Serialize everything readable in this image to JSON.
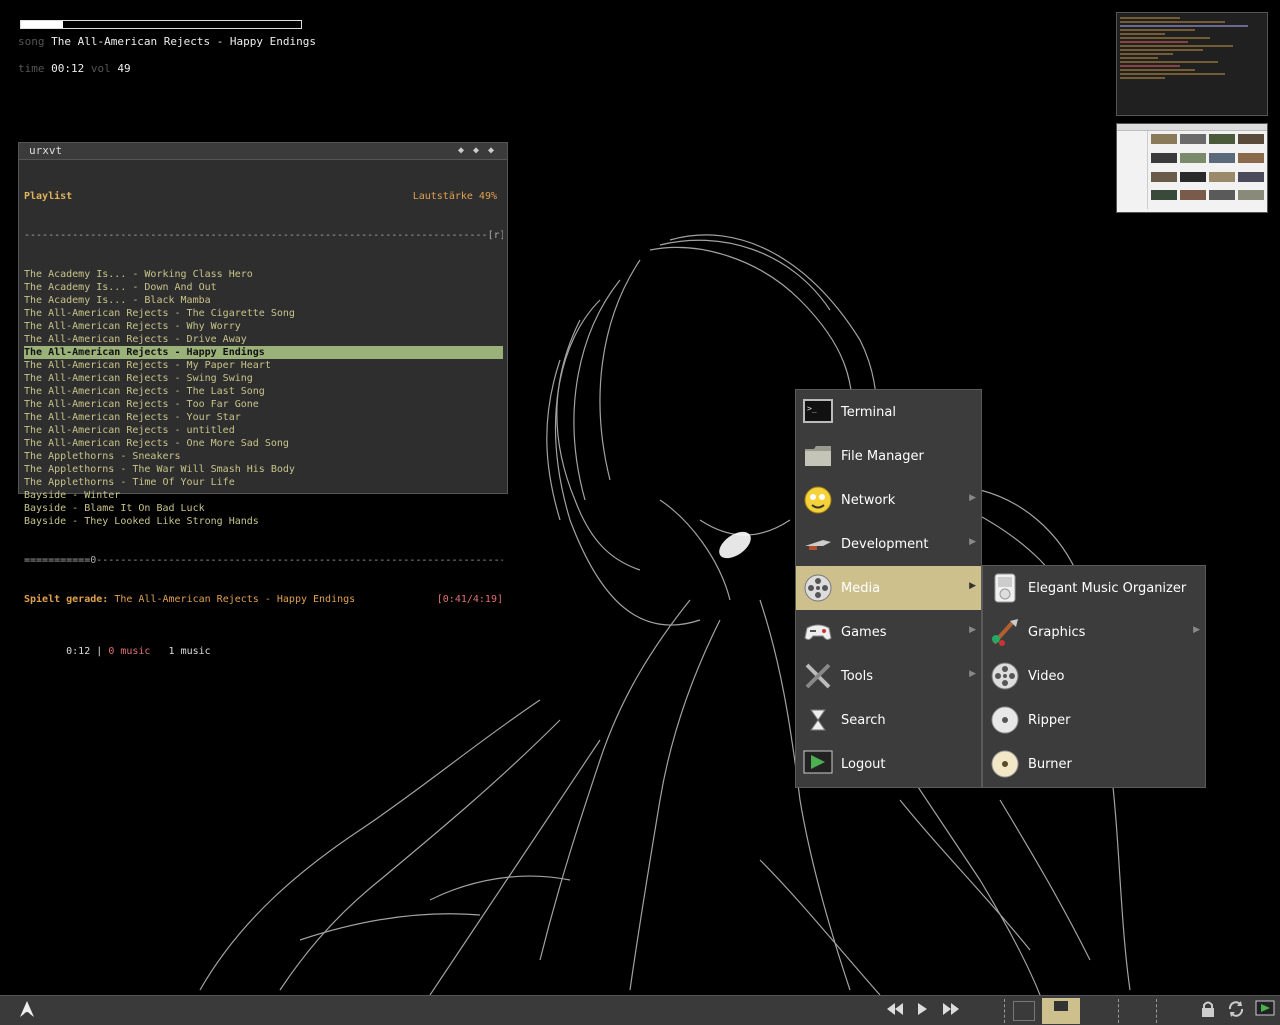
{
  "conky": {
    "progress": 0.15,
    "song_label": "song",
    "song": "The All-American Rejects - Happy Endings",
    "time_label": "time",
    "time": "00:12",
    "vol_label": "vol",
    "vol": "49"
  },
  "terminal": {
    "title": "urxvt",
    "playlist_title": "Playlist",
    "volume": "Lautstärke 49%",
    "top_separator": "-----------------------------------------------------------------------------[r]-",
    "tracks": [
      "The Academy Is... - Working Class Hero",
      "The Academy Is... - Down And Out",
      "The Academy Is... - Black Mamba",
      "The All-American Rejects - The Cigarette Song",
      "The All-American Rejects - Why Worry",
      "The All-American Rejects - Drive Away",
      "The All-American Rejects - Happy Endings",
      "The All-American Rejects - My Paper Heart",
      "The All-American Rejects - Swing Swing",
      "The All-American Rejects - The Last Song",
      "The All-American Rejects - Too Far Gone",
      "The All-American Rejects - Your Star",
      "The All-American Rejects - untitled",
      "The All-American Rejects - One More Sad Song",
      "The Applethorns - Sneakers",
      "The Applethorns - The War Will Smash His Body",
      "The Applethorns - Time Of Your Life",
      "Bayside - Winter",
      "Bayside - Blame It On Bad Luck",
      "Bayside - They Looked Like Strong Hands"
    ],
    "selected_index": 6,
    "bottom_separator": "===========0--------------------------------------------------------------------",
    "now_playing_label": "Spielt gerade:",
    "now_playing": "The All-American Rejects - Happy Endings",
    "position": "[0:41/4:19]",
    "status_time": " 0:12 |",
    "status_music_red": "0 music",
    "status_music": "1 music"
  },
  "main_menu": [
    {
      "label": "Terminal",
      "icon": "terminal-icon",
      "submenu": false
    },
    {
      "label": "File Manager",
      "icon": "folder-icon",
      "submenu": false
    },
    {
      "label": "Network",
      "icon": "network-icon",
      "submenu": true
    },
    {
      "label": "Development",
      "icon": "development-icon",
      "submenu": true
    },
    {
      "label": "Media",
      "icon": "film-reel-icon",
      "submenu": true,
      "active": true
    },
    {
      "label": "Games",
      "icon": "gamepad-icon",
      "submenu": true
    },
    {
      "label": "Tools",
      "icon": "tools-icon",
      "submenu": true
    },
    {
      "label": "Search",
      "icon": "hourglass-icon",
      "submenu": false
    },
    {
      "label": "Logout",
      "icon": "logout-icon",
      "submenu": false
    }
  ],
  "media_menu": [
    {
      "label": "Elegant Music Organizer",
      "icon": "music-player-icon",
      "submenu": false
    },
    {
      "label": "Graphics",
      "icon": "paintbrush-icon",
      "submenu": true
    },
    {
      "label": "Video",
      "icon": "film-reel-icon",
      "submenu": false
    },
    {
      "label": "Ripper",
      "icon": "cd-icon",
      "submenu": false
    },
    {
      "label": "Burner",
      "icon": "cd-burn-icon",
      "submenu": false
    }
  ],
  "colors": {
    "menu_active": "#cdc08d",
    "playlist_selected": "#9bb17a"
  }
}
